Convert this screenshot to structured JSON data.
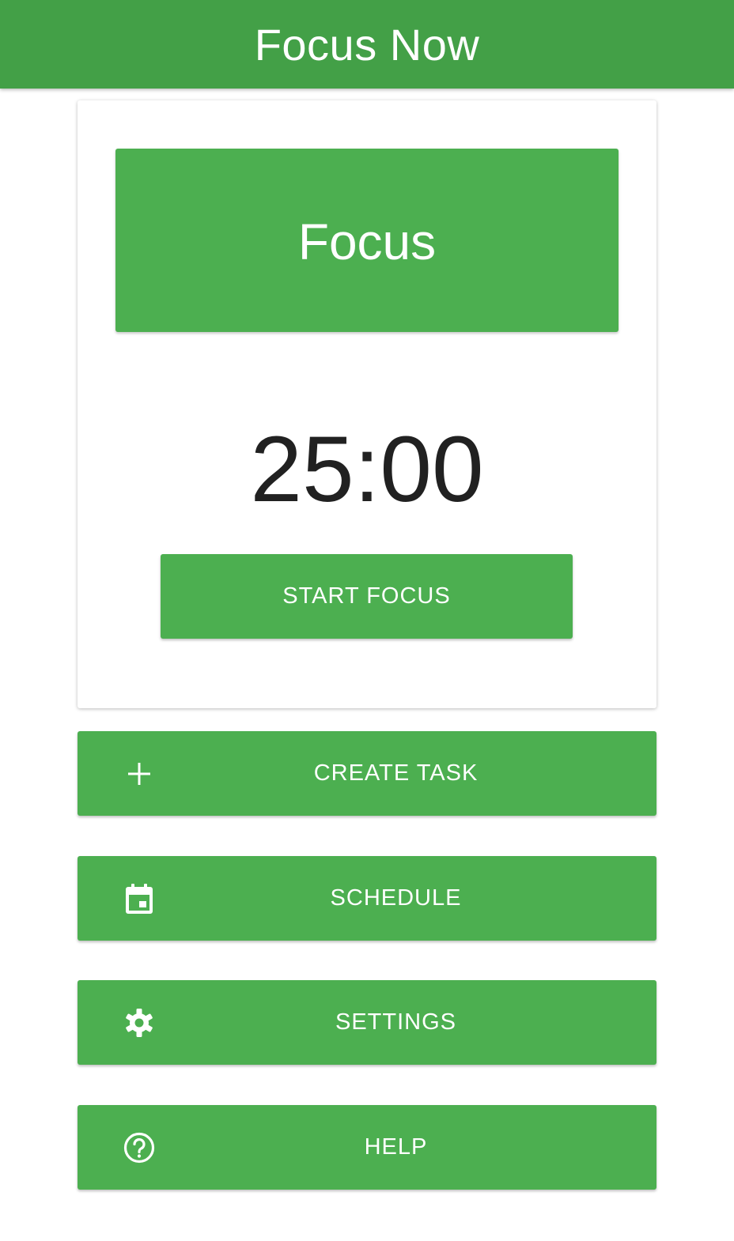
{
  "app_bar": {
    "title": "Focus Now"
  },
  "timer_card": {
    "mode_label": "Focus",
    "time_display": "25:00",
    "start_button_label": "START FOCUS"
  },
  "actions": [
    {
      "label": "CREATE TASK",
      "icon": "plus-icon"
    },
    {
      "label": "SCHEDULE",
      "icon": "calendar-icon"
    },
    {
      "label": "SETTINGS",
      "icon": "gear-icon"
    },
    {
      "label": "HELP",
      "icon": "help-circle-icon"
    }
  ],
  "colors": {
    "app_bar": "#43a047",
    "primary": "#4caf50",
    "on_primary": "#ffffff",
    "timer_text": "#212121"
  }
}
